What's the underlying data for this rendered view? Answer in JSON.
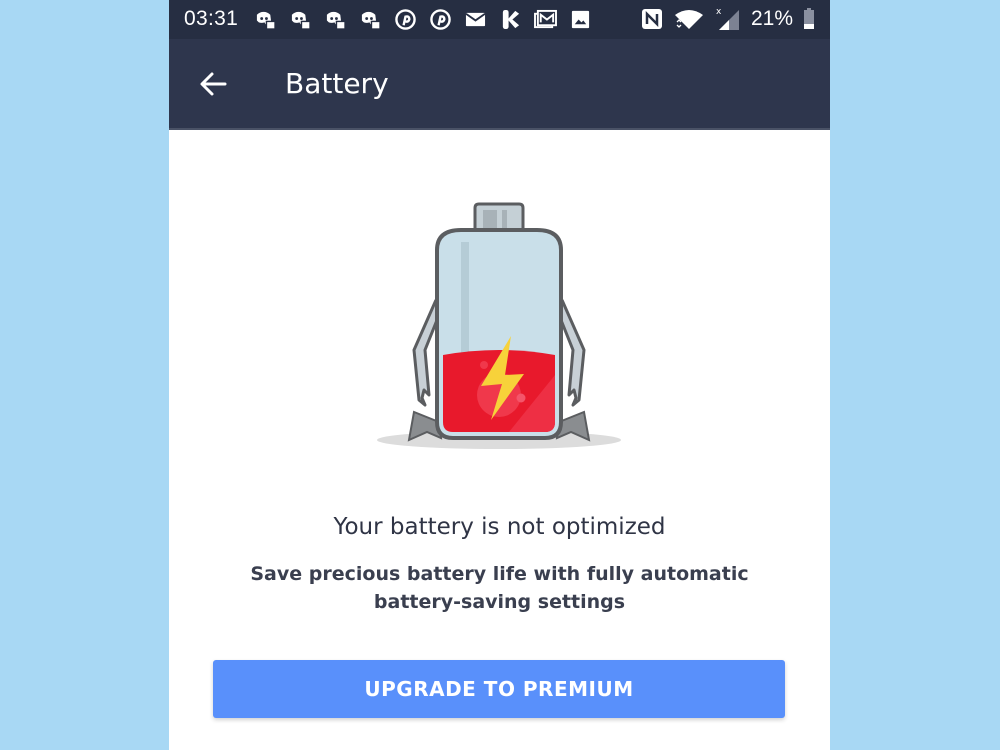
{
  "status_bar": {
    "time": "03:31",
    "notification_icons": [
      "discord-icon",
      "discord-icon",
      "discord-icon",
      "discord-icon",
      "pinterest-icon",
      "pinterest-icon",
      "mail-icon",
      "kik-icon",
      "gmail-icon",
      "image-icon"
    ],
    "system_icons": [
      "nfc-icon",
      "wifi-icon",
      "cell-signal-icon",
      "battery-icon"
    ],
    "battery_percent": "21%"
  },
  "toolbar": {
    "back_icon": "arrow-left-icon",
    "title": "Battery"
  },
  "illustration": {
    "subject": "battery-character-icon",
    "charge_level": 0.33
  },
  "content": {
    "headline": "Your battery is not optimized",
    "subtext": "Save precious battery life with fully automatic battery-saving settings"
  },
  "cta": {
    "label": "UPGRADE TO PREMIUM"
  },
  "colors": {
    "status_bar_bg": "#262e42",
    "toolbar_bg": "#2e364d",
    "cta_bg": "#5990fb",
    "page_bg": "#a8d8f4",
    "battery_red": "#e8192c",
    "bolt_yellow": "#f7d23a"
  }
}
